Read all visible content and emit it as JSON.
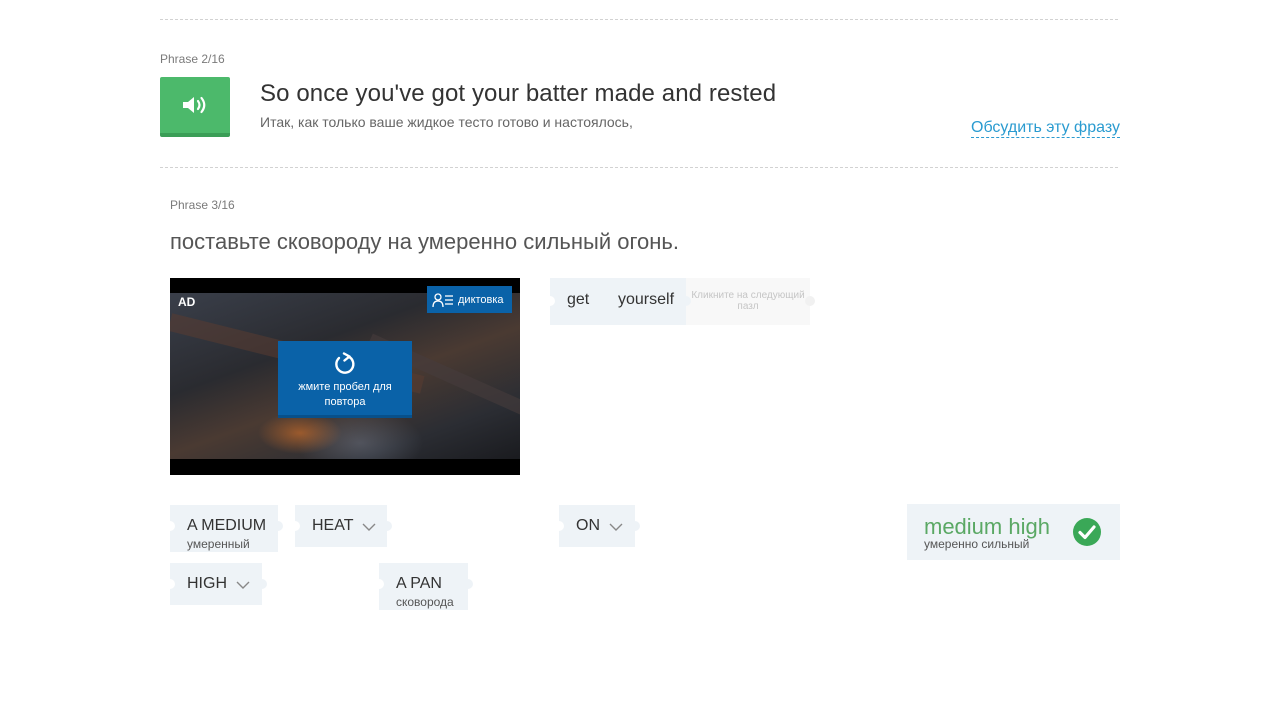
{
  "phrase2": {
    "label": "Phrase 2/16",
    "english": "So once you've got your batter made and rested",
    "russian": "Итак, как только ваше жидкое тесто готово и настоялось,",
    "audio_icon": "speaker-icon",
    "discuss_label": "Обсудить эту фразу"
  },
  "phrase3": {
    "label": "Phrase 3/16",
    "russian": "поставьте сковороду на умеренно сильный огонь.",
    "video": {
      "ad_label": "AD",
      "dictation_label": "диктовка",
      "replay_label": "жмите пробел для повтора"
    },
    "answer_words": [
      "get",
      "yourself"
    ],
    "next_slot_label": "Кликните на следующий пазл",
    "tiles": [
      {
        "id": "a-medium",
        "word": "A MEDIUM",
        "translation": "умеренный",
        "has_dropdown": false
      },
      {
        "id": "heat",
        "word": "HEAT",
        "translation": "",
        "has_dropdown": true
      },
      {
        "id": "on",
        "word": "ON",
        "translation": "",
        "has_dropdown": true
      },
      {
        "id": "high",
        "word": "HIGH",
        "translation": "",
        "has_dropdown": true
      },
      {
        "id": "a-pan",
        "word": "A PAN",
        "translation": "сковорода",
        "has_dropdown": false
      }
    ],
    "correct": {
      "word": "medium high",
      "translation": "умеренно сильный",
      "icon": "check-circle-icon"
    }
  },
  "colors": {
    "green": "#4cb96b",
    "blue": "#0a62a8",
    "link": "#2a9bd0",
    "tile_bg": "#eef3f7",
    "correct_text": "#5aa864"
  }
}
